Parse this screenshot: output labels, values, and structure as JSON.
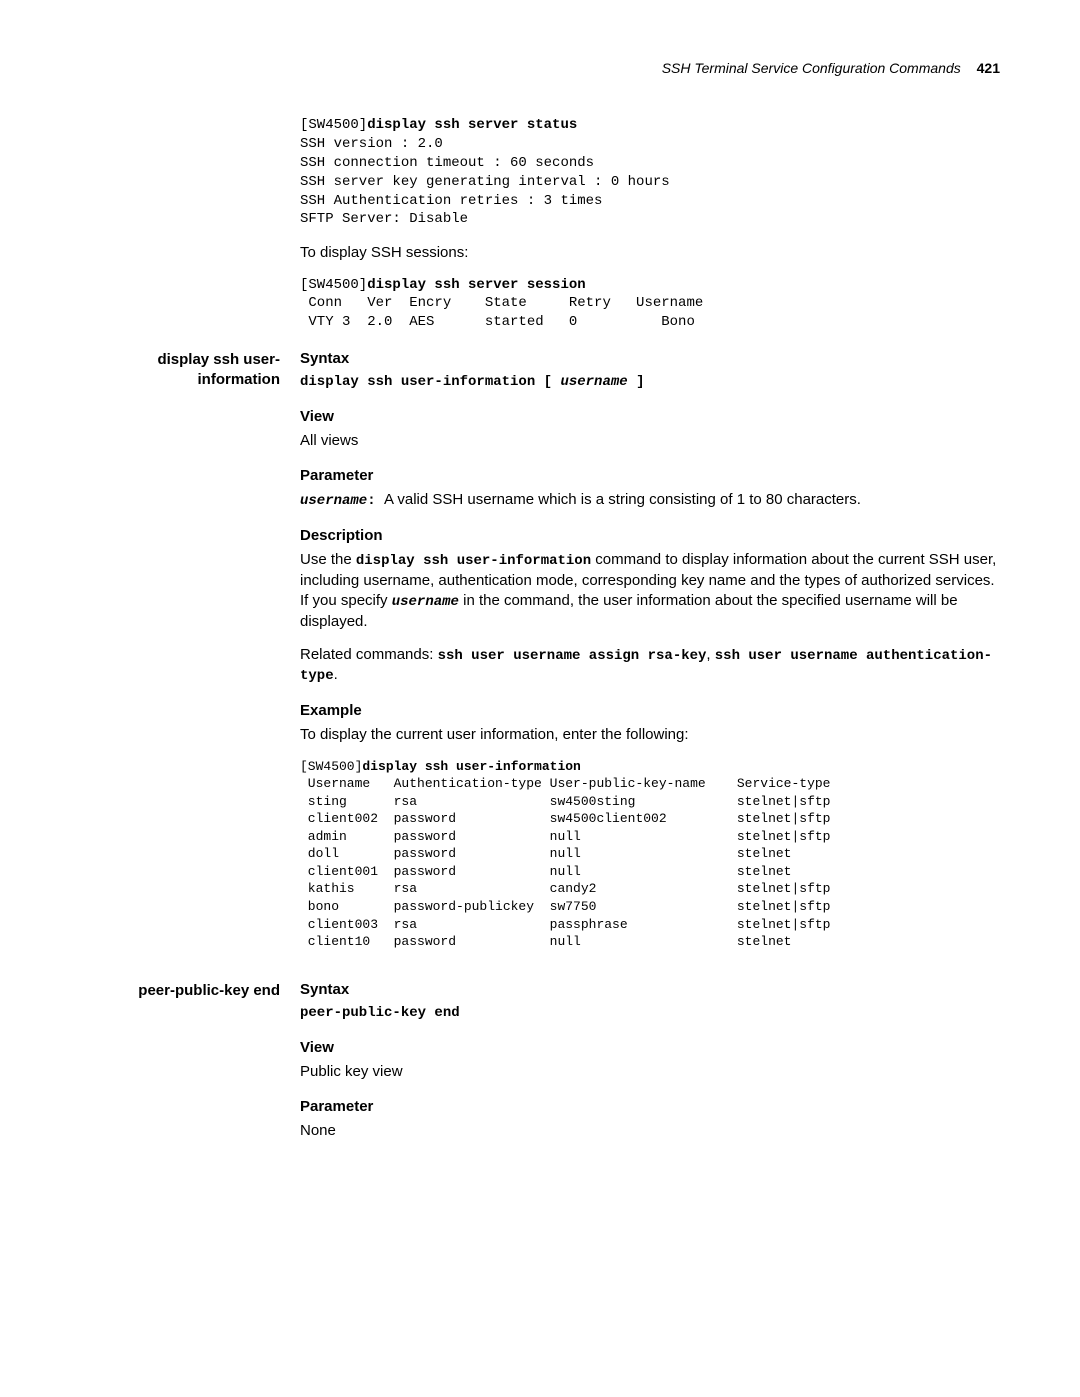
{
  "header": {
    "title": "SSH Terminal Service Configuration Commands",
    "page": "421"
  },
  "block1": {
    "code": "[SW4500]display ssh server status\nSSH version : 2.0\nSSH connection timeout : 60 seconds\nSSH server key generating interval : 0 hours\nSSH Authentication retries : 3 times\nSFTP Server: Disable",
    "code_prefix": "[SW4500]",
    "code_cmd": "display ssh server status",
    "code_rest": "SSH version : 2.0\nSSH connection timeout : 60 seconds\nSSH server key generating interval : 0 hours\nSSH Authentication retries : 3 times\nSFTP Server: Disable",
    "sessions_intro": "To display SSH sessions:",
    "sessions_prefix": "[SW4500]",
    "sessions_cmd": "display ssh server session",
    "sessions_body": " Conn   Ver  Encry    State     Retry   Username\n VTY 3  2.0  AES      started   0          Bono"
  },
  "section1": {
    "title": "display ssh user-information",
    "syntax_h": "Syntax",
    "syntax_pre": "display ssh user-information [ ",
    "syntax_var": "username",
    "syntax_post": " ]",
    "view_h": "View",
    "view_b": "All views",
    "param_h": "Parameter",
    "param_var": "username",
    "param_colon": ": ",
    "param_b": "A valid SSH username which is a string consisting of 1 to 80 characters.",
    "desc_h": "Description",
    "desc_pre": "Use the ",
    "desc_cmd": "display ssh user-information",
    "desc_mid": " command to display information about the current SSH user, including username, authentication mode, corresponding key name and the types of authorized services. If you specify ",
    "desc_var": "username",
    "desc_post": " in the command, the user information about the specified username will be displayed.",
    "related_pre": "Related commands: ",
    "related_cmd1": "ssh user username assign rsa-key",
    "related_sep": ", ",
    "related_cmd2": "ssh user username authentication-type",
    "related_dot": ".",
    "example_h": "Example",
    "example_b": "To display the current user information, enter the following:",
    "example_prefix": "[SW4500]",
    "example_cmd": "display ssh user-information",
    "example_body": " Username   Authentication-type User-public-key-name    Service-type\n sting      rsa                 sw4500sting             stelnet|sftp\n client002  password            sw4500client002         stelnet|sftp\n admin      password            null                    stelnet|sftp\n doll       password            null                    stelnet\n client001  password            null                    stelnet\n kathis     rsa                 candy2                  stelnet|sftp\n bono       password-publickey  sw7750                  stelnet|sftp\n client003  rsa                 passphrase              stelnet|sftp\n client10   password            null                    stelnet"
  },
  "section2": {
    "title": "peer-public-key end",
    "syntax_h": "Syntax",
    "syntax_cmd": "peer-public-key end",
    "view_h": "View",
    "view_b": "Public key view",
    "param_h": "Parameter",
    "param_b": "None"
  }
}
